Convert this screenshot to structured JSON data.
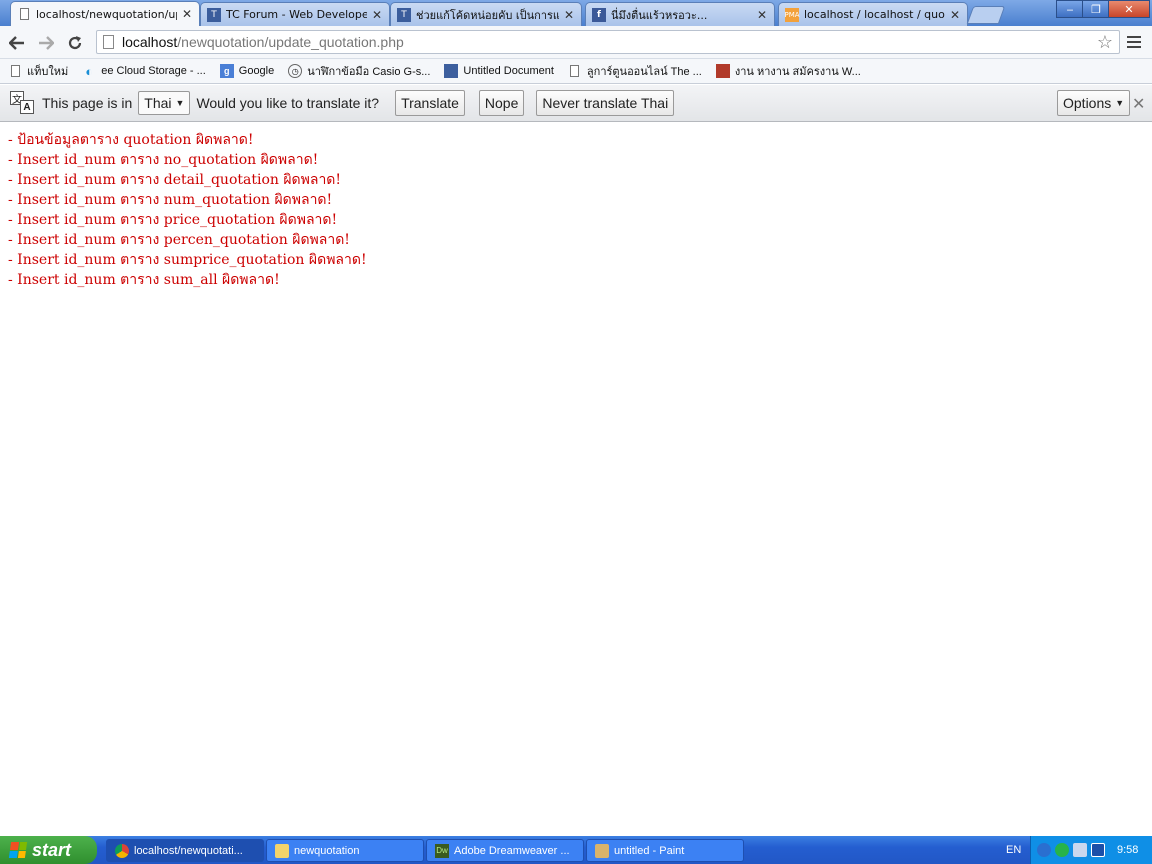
{
  "browser": {
    "tabs": [
      {
        "title": "localhost/newquotation/upda",
        "active": true
      },
      {
        "title": "TC Forum - Web Developer W",
        "active": false
      },
      {
        "title": "ช่วยแก้โค้ดหน่อยคับ เป็นการแ",
        "active": false
      },
      {
        "title": "นี่มึงตื่นแร้วหรอวะ...",
        "active": false
      },
      {
        "title": "localhost / localhost / quotati",
        "active": false
      }
    ],
    "close_glyph": "✕",
    "window_controls": {
      "minimize": "‒",
      "maximize": "❐",
      "close": "✕"
    },
    "address": {
      "host": "localhost",
      "path": "/newquotation/update_quotation.php"
    },
    "bookmarks": [
      {
        "label": "แท็บใหม่",
        "icon": "page-icon"
      },
      {
        "label": "ee Cloud Storage - ...",
        "icon": "cloud-icon"
      },
      {
        "label": "Google",
        "icon": "google-icon"
      },
      {
        "label": "นาฬิกาข้อมือ Casio G-s...",
        "icon": "clock-icon"
      },
      {
        "label": "Untitled Document",
        "icon": "building-icon"
      },
      {
        "label": "ลูการ์ตูนออนไลน์ The ...",
        "icon": "page-icon"
      },
      {
        "label": "งาน หางาน สมัครงาน W...",
        "icon": "jobs-icon"
      }
    ]
  },
  "translate_bar": {
    "prefix": "This page is in",
    "language": "Thai",
    "question": "Would you like to translate it?",
    "translate": "Translate",
    "nope": "Nope",
    "never": "Never translate Thai",
    "options": "Options",
    "close": "✕"
  },
  "content": {
    "messages": [
      "- ป้อนข้อมูลตาราง quotation ผิดพลาด!",
      "- Insert id_num ตาราง no_quotation ผิดพลาด!",
      "- Insert id_num ตาราง detail_quotation ผิดพลาด!",
      "- Insert id_num ตาราง num_quotation ผิดพลาด!",
      "- Insert id_num ตาราง price_quotation ผิดพลาด!",
      "- Insert id_num ตาราง percen_quotation ผิดพลาด!",
      "- Insert id_num ตาราง sumprice_quotation ผิดพลาด!",
      "- Insert id_num ตาราง sum_all ผิดพลาด!"
    ],
    "color": "#cc0000"
  },
  "taskbar": {
    "start": "start",
    "tasks": [
      {
        "label": "localhost/newquotati...",
        "icon": "chrome-icon",
        "active": true
      },
      {
        "label": "newquotation",
        "icon": "folder-icon",
        "active": false
      },
      {
        "label": "Adobe Dreamweaver ...",
        "icon": "dreamweaver-icon",
        "active": false
      },
      {
        "label": "untitled - Paint",
        "icon": "paint-icon",
        "active": false
      }
    ],
    "language": "EN",
    "clock": "9:58"
  }
}
